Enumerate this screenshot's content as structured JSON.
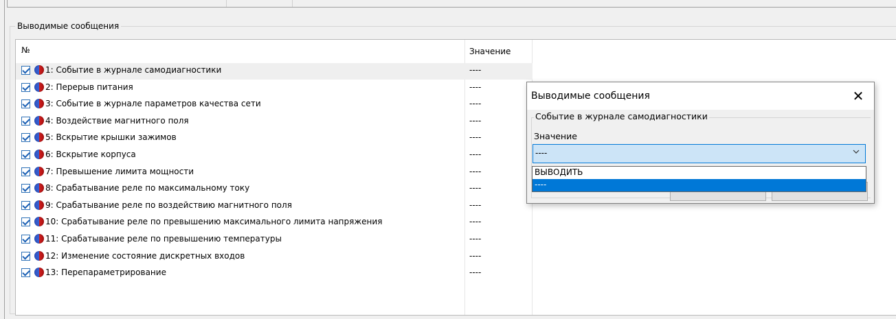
{
  "group": {
    "title": "Выводимые сообщения"
  },
  "list": {
    "columns": {
      "num": "№",
      "value": "Значение"
    },
    "rows": [
      {
        "label": "1: Событие в журнале самодиагностики",
        "value": "----",
        "checked": true
      },
      {
        "label": "2: Перерыв питания",
        "value": "----",
        "checked": true
      },
      {
        "label": "3: Событие в журнале параметров качества сети",
        "value": "----",
        "checked": true
      },
      {
        "label": "4: Воздействие магнитного поля",
        "value": "----",
        "checked": true
      },
      {
        "label": "5: Вскрытие крышки зажимов",
        "value": "----",
        "checked": true
      },
      {
        "label": "6: Вскрытие корпуса",
        "value": "----",
        "checked": true
      },
      {
        "label": "7: Превышение лимита мощности",
        "value": "----",
        "checked": true
      },
      {
        "label": "8: Срабатывание реле по максимальному току",
        "value": "----",
        "checked": true
      },
      {
        "label": "9: Срабатывание реле по воздействию магнитного поля",
        "value": "----",
        "checked": true
      },
      {
        "label": "10: Срабатывание реле по превышению максимального лимита напряжения",
        "value": "----",
        "checked": true
      },
      {
        "label": "11: Срабатывание реле по превышению температуры",
        "value": "----",
        "checked": true
      },
      {
        "label": "12: Изменение состояние дискретных входов",
        "value": "----",
        "checked": true
      },
      {
        "label": "13: Перепараметрирование",
        "value": "----",
        "checked": true
      }
    ]
  },
  "dialog": {
    "title": "Выводимые сообщения",
    "close": "✕",
    "group_title": "Событие в журнале самодиагностики",
    "field_label": "Значение",
    "combo_value": "----",
    "options": [
      "ВЫВОДИТЬ",
      "----"
    ],
    "selected_option": "----"
  },
  "colors": {
    "accent": "#0078d7",
    "combo_bg": "#cce4f7",
    "selected_row": "#efefef"
  },
  "icons": {
    "check": "checkbox-checked-icon",
    "status": "status-ball-icon",
    "chevron": "chevron-down-icon"
  }
}
